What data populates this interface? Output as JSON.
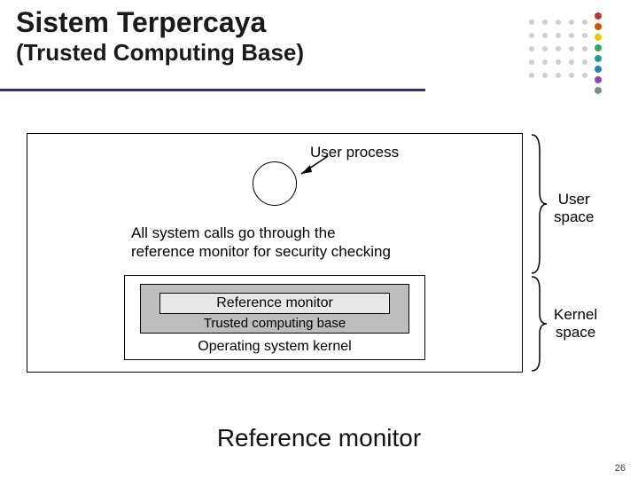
{
  "title": {
    "main": "Sistem Terpercaya",
    "sub_prefix": "(",
    "sub_text": "Trusted Computing Base)",
    "underline_color": "#3a2d6b"
  },
  "logo": {
    "dot_colors": [
      "#b33939",
      "#d35400",
      "#f1c40f",
      "#27ae60",
      "#16a085",
      "#2980b9",
      "#8e44ad",
      "#7f8c8d"
    ]
  },
  "diagram": {
    "user_process_label": "User process",
    "syscall_text_line1": "All system calls go through the",
    "syscall_text_line2": "reference monitor for security checking",
    "reference_monitor_label": "Reference monitor",
    "tcb_label": "Trusted computing base",
    "os_kernel_label": "Operating system kernel",
    "user_space_label_l1": "User",
    "user_space_label_l2": "space",
    "kernel_space_label_l1": "Kernel",
    "kernel_space_label_l2": "space"
  },
  "caption": "Reference monitor",
  "page_number": "26"
}
